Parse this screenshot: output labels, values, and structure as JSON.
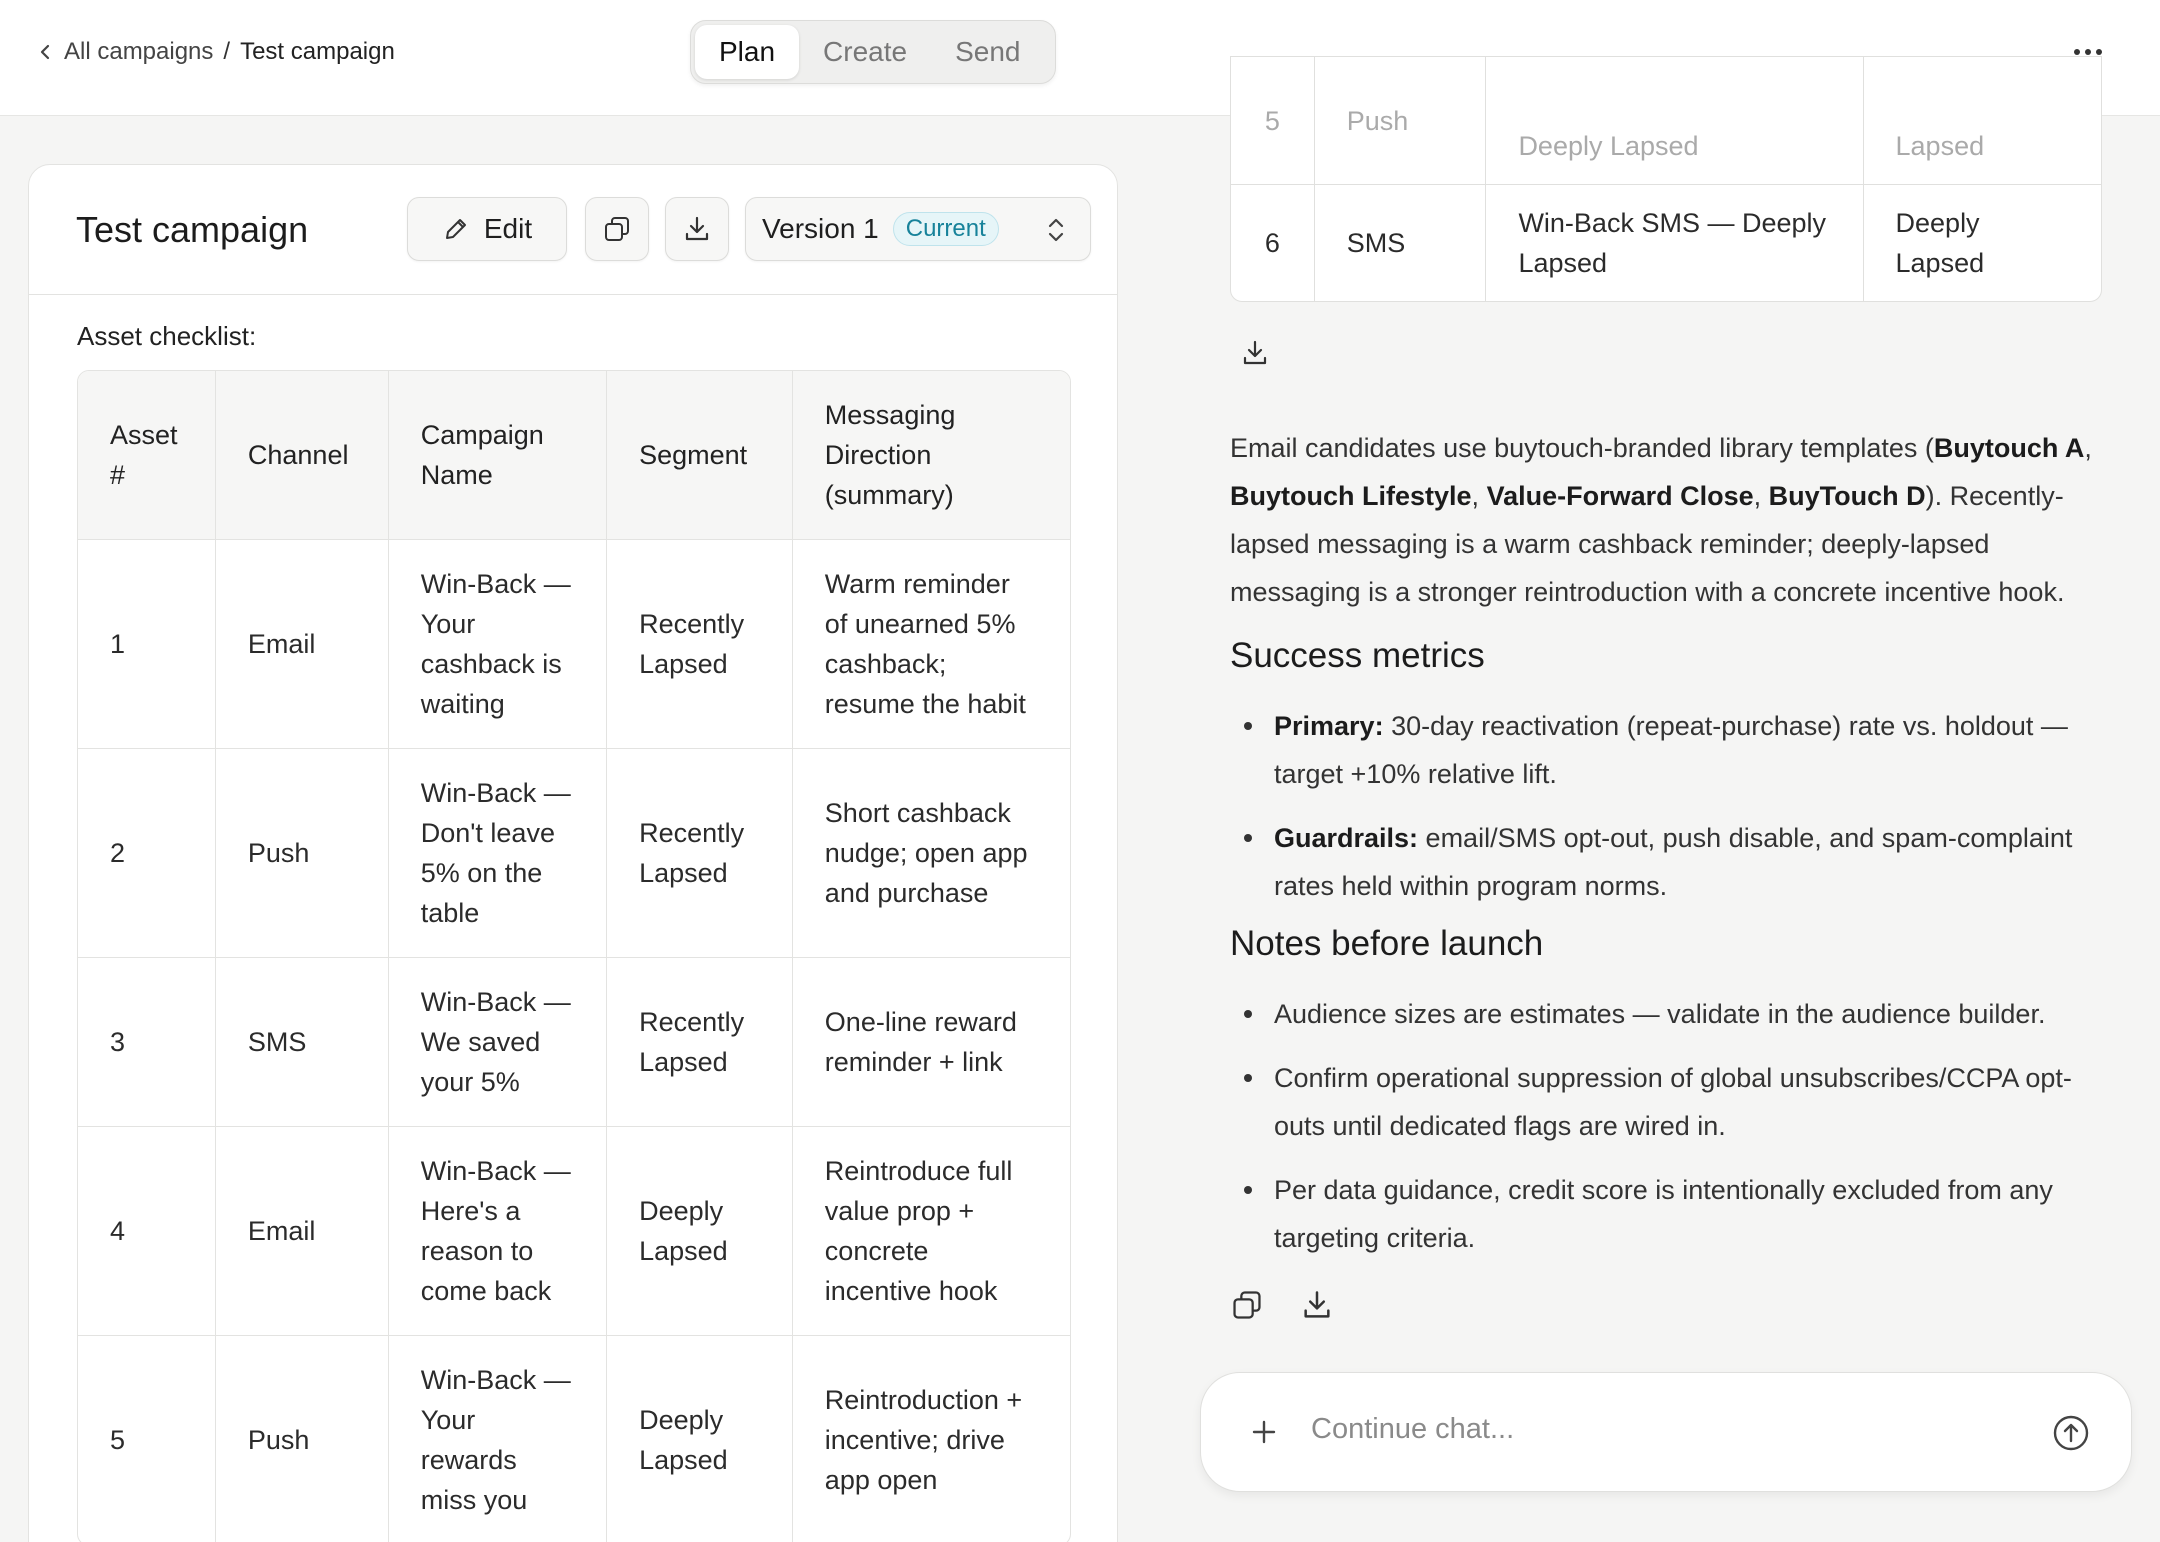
{
  "breadcrumb": {
    "parent": "All campaigns",
    "separator": "/",
    "current": "Test campaign"
  },
  "tabs": [
    "Plan",
    "Create",
    "Send"
  ],
  "active_tab": "Plan",
  "panel": {
    "title": "Test campaign",
    "edit_label": "Edit",
    "version_label": "Version 1",
    "current_badge": "Current",
    "checklist_label": "Asset checklist:",
    "columns": [
      "Asset #",
      "Channel",
      "Campaign Name",
      "Segment",
      "Messaging Direction (summary)"
    ],
    "rows": [
      [
        "1",
        "Email",
        "Win-Back — Your cashback is waiting",
        "Recently Lapsed",
        "Warm reminder of unearned 5% cashback; resume the habit"
      ],
      [
        "2",
        "Push",
        "Win-Back — Don't leave 5% on the table",
        "Recently Lapsed",
        "Short cashback nudge; open app and purchase"
      ],
      [
        "3",
        "SMS",
        "Win-Back — We saved your 5%",
        "Recently Lapsed",
        "One-line reward reminder + link"
      ],
      [
        "4",
        "Email",
        "Win-Back — Here's a reason to come back",
        "Deeply Lapsed",
        "Reintroduce full value prop + concrete incentive hook"
      ],
      [
        "5",
        "Push",
        "Win-Back — Your rewards miss you",
        "Deeply Lapsed",
        "Reintroduction + incentive; drive app open"
      ]
    ]
  },
  "chat_table": {
    "faded_row": [
      "5",
      "Push",
      "Deeply Lapsed",
      "Lapsed"
    ],
    "row": [
      "6",
      "SMS",
      "Win-Back SMS — Deeply Lapsed",
      "Deeply Lapsed"
    ]
  },
  "chat": {
    "para_1": "Email candidates use buytouch-branded library templates (",
    "bold_1": "Buytouch A",
    "sep_1": ", ",
    "bold_2": "Buytouch Lifestyle",
    "sep_2": ", ",
    "bold_3": "Value-Forward Close",
    "sep_3": ", ",
    "bold_4": "BuyTouch D",
    "para_2": "). Recently-lapsed messaging is a warm cashback reminder; deeply-lapsed messaging is a stronger reintroduction with a concrete incentive hook.",
    "success_heading": "Success metrics",
    "primary_label": "Primary:",
    "primary_text": " 30-day reactivation (repeat-purchase) rate vs. holdout — target +10% relative lift.",
    "guardrails_label": "Guardrails:",
    "guardrails_text": " email/SMS opt-out, push disable, and spam-complaint rates held within program norms.",
    "notes_heading": "Notes before launch",
    "notes": [
      "Audience sizes are estimates — validate in the audience builder.",
      "Confirm operational suppression of global unsubscribes/CCPA opt-outs until dedicated flags are wired in.",
      "Per data guidance, credit score is intentionally excluded from any targeting criteria."
    ],
    "input_placeholder": "Continue chat..."
  }
}
